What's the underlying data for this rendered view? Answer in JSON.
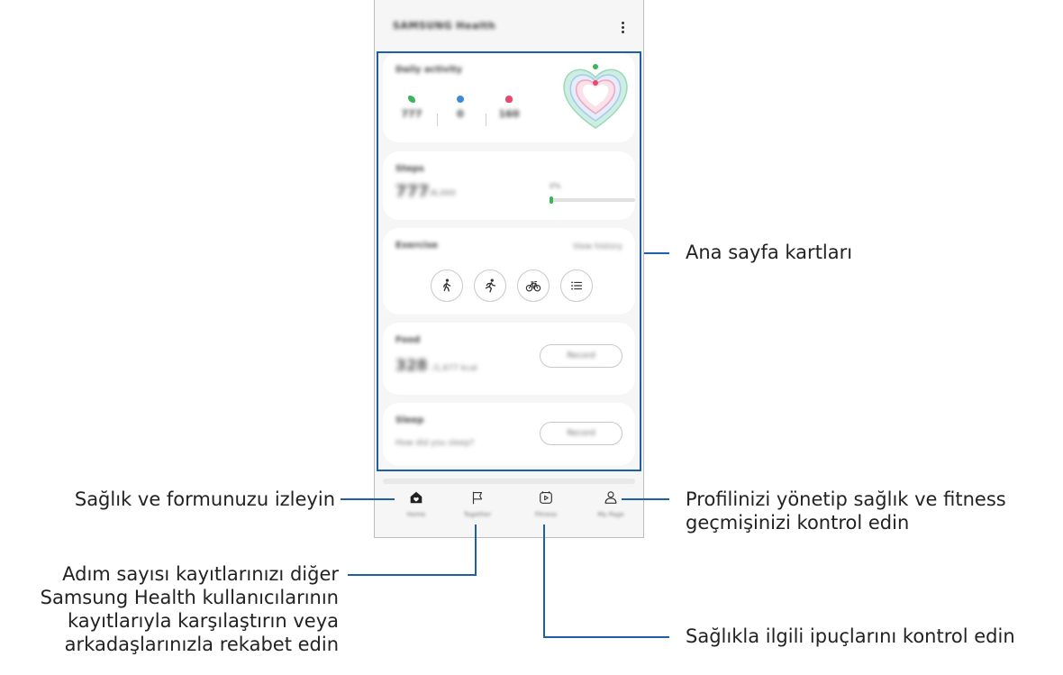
{
  "app": {
    "title": "SAMSUNG Health",
    "menu_icon": "more-vertical-icon"
  },
  "cards": {
    "daily_activity": {
      "title": "Daily activity",
      "steps": "777",
      "active_minutes": "0",
      "calories": "160",
      "colors": {
        "steps": "#3cb45a",
        "minutes": "#3c8ad8",
        "calories": "#e8486e"
      }
    },
    "steps": {
      "title": "Steps",
      "count": "777",
      "unit": "/6,000",
      "goal_label": "0%",
      "progress": 0.03
    },
    "exercise": {
      "title": "Exercise",
      "history_link": "View history",
      "buttons": [
        "walking-icon",
        "running-icon",
        "cycling-icon",
        "list-icon"
      ]
    },
    "food": {
      "title": "Food",
      "count": "328",
      "unit": "/1,677 kcal",
      "button": "Record"
    },
    "sleep": {
      "title": "Sleep",
      "question": "How did you sleep?",
      "button": "Record"
    }
  },
  "bottom_nav": [
    {
      "icon": "home-icon",
      "label": "Home"
    },
    {
      "icon": "flag-icon",
      "label": "Together"
    },
    {
      "icon": "play-icon",
      "label": "Fitness"
    },
    {
      "icon": "person-icon",
      "label": "My Page"
    }
  ],
  "annotations": {
    "home_cards": "Ana sayfa kartları",
    "track_health": "Sağlık ve formunuzu izleyin",
    "profile": [
      "Profilinizi yönetip sağlık ve fitness",
      "geçmişinizi kontrol edin"
    ],
    "together": [
      "Adım sayısı kayıtlarınızı diğer",
      "Samsung Health kullanıcılarının",
      "kayıtlarıyla karşılaştırın veya",
      "arkadaşlarınızla rekabet edin"
    ],
    "tips": "Sağlıkla ilgili ipuçlarını kontrol edin"
  },
  "colors": {
    "callout_line": "#1f5fa3",
    "steps_green": "#3cb45a"
  }
}
